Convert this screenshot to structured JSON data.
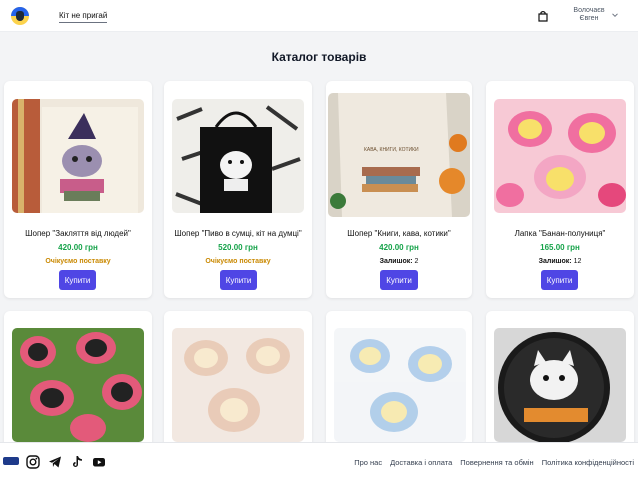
{
  "header": {
    "brand": "Кіт не пригай",
    "user_line1": "Волочаєв",
    "user_line2": "Євген"
  },
  "title": "Каталог товарів",
  "products": [
    {
      "name": "Шопер \"Закляття від людей\"",
      "price": "420.00 грн",
      "status": "Очікуємо поставку",
      "buy": "Купити"
    },
    {
      "name": "Шопер \"Пиво в сумці, кіт на думці\"",
      "price": "520.00 грн",
      "status": "Очікуємо поставку",
      "buy": "Купити"
    },
    {
      "name": "Шопер \"Книги, кава, котики\"",
      "price": "420.00 грн",
      "stock_label": "Залишок:",
      "stock_value": "2",
      "buy": "Купити"
    },
    {
      "name": "Лапка \"Банан-полуниця\"",
      "price": "165.00 грн",
      "stock_label": "Залишок:",
      "stock_value": "12",
      "buy": "Купити"
    }
  ],
  "footer": {
    "links": [
      "Про нас",
      "Доставка і оплата",
      "Повернення та обмін",
      "Політика конфіденційності"
    ],
    "socials": [
      "instagram-icon",
      "telegram-icon",
      "tiktok-icon",
      "youtube-icon"
    ]
  },
  "colors": {
    "accent": "#4f46e5",
    "price": "#16a34a",
    "status": "#ca8a04"
  }
}
